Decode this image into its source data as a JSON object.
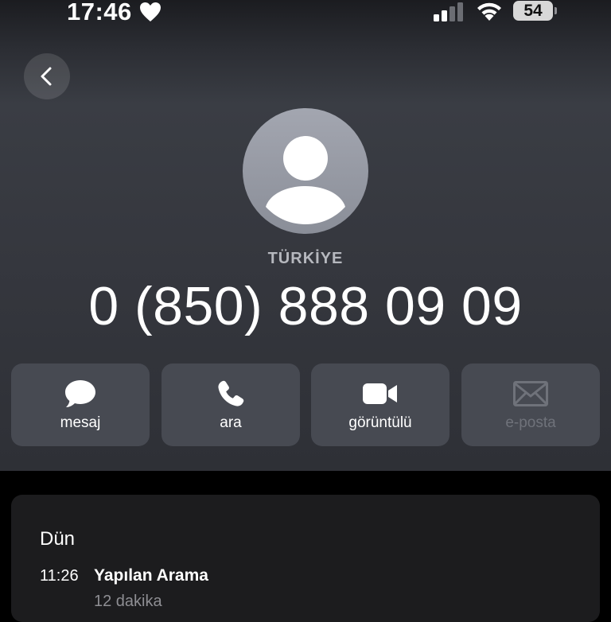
{
  "status_bar": {
    "time": "17:46",
    "battery": "54",
    "icons": [
      "heart-icon",
      "cellular-signal-icon",
      "wifi-icon",
      "battery-icon"
    ]
  },
  "nav": {
    "back_icon": "chevron-left-icon"
  },
  "contact": {
    "country": "TÜRKİYE",
    "phone": "0 (850) 888 09 09",
    "avatar_icon": "person-silhouette-icon"
  },
  "actions": [
    {
      "label": "mesaj",
      "icon": "message-bubble-icon",
      "enabled": true
    },
    {
      "label": "ara",
      "icon": "phone-icon",
      "enabled": true
    },
    {
      "label": "görüntülü",
      "icon": "video-camera-icon",
      "enabled": true
    },
    {
      "label": "e-posta",
      "icon": "envelope-icon",
      "enabled": false
    }
  ],
  "recents": {
    "day": "Dün",
    "entries": [
      {
        "time": "11:26",
        "type": "Yapılan Arama",
        "duration": "12 dakika"
      }
    ]
  },
  "colors": {
    "header_gradient_top": "#1b1c20",
    "header_gradient_mid": "#3a3d44",
    "action_bg": "#474a52",
    "card_bg": "#1c1c1e",
    "secondary_text": "#8e8e93"
  }
}
